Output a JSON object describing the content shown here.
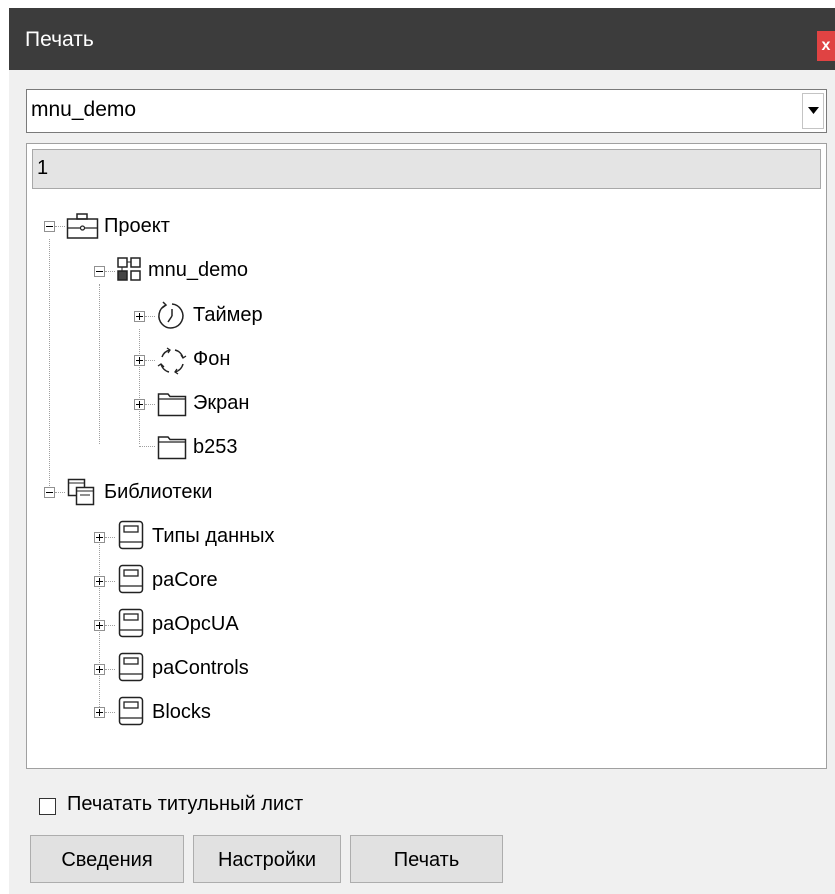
{
  "window": {
    "title": "Печать",
    "close_glyph": "x",
    "close_color": "#e04343"
  },
  "combo": {
    "value": "mnu_demo"
  },
  "tree": {
    "header": "1",
    "nodes": {
      "project": "Проект",
      "mnu_demo": "mnu_demo",
      "timer": "Таймер",
      "background": "Фон",
      "screen": "Экран",
      "b253": "b253",
      "libraries": "Библиотеки",
      "datatypes": "Типы данных",
      "pacore": "paCore",
      "paopcua": "paOpcUA",
      "pacontrols": "paControls",
      "blocks": "Blocks"
    }
  },
  "options": {
    "print_title_page": {
      "label": "Печатать титульный лист",
      "checked": false
    }
  },
  "buttons": {
    "info": "Сведения",
    "settings": "Настройки",
    "print": "Печать"
  }
}
